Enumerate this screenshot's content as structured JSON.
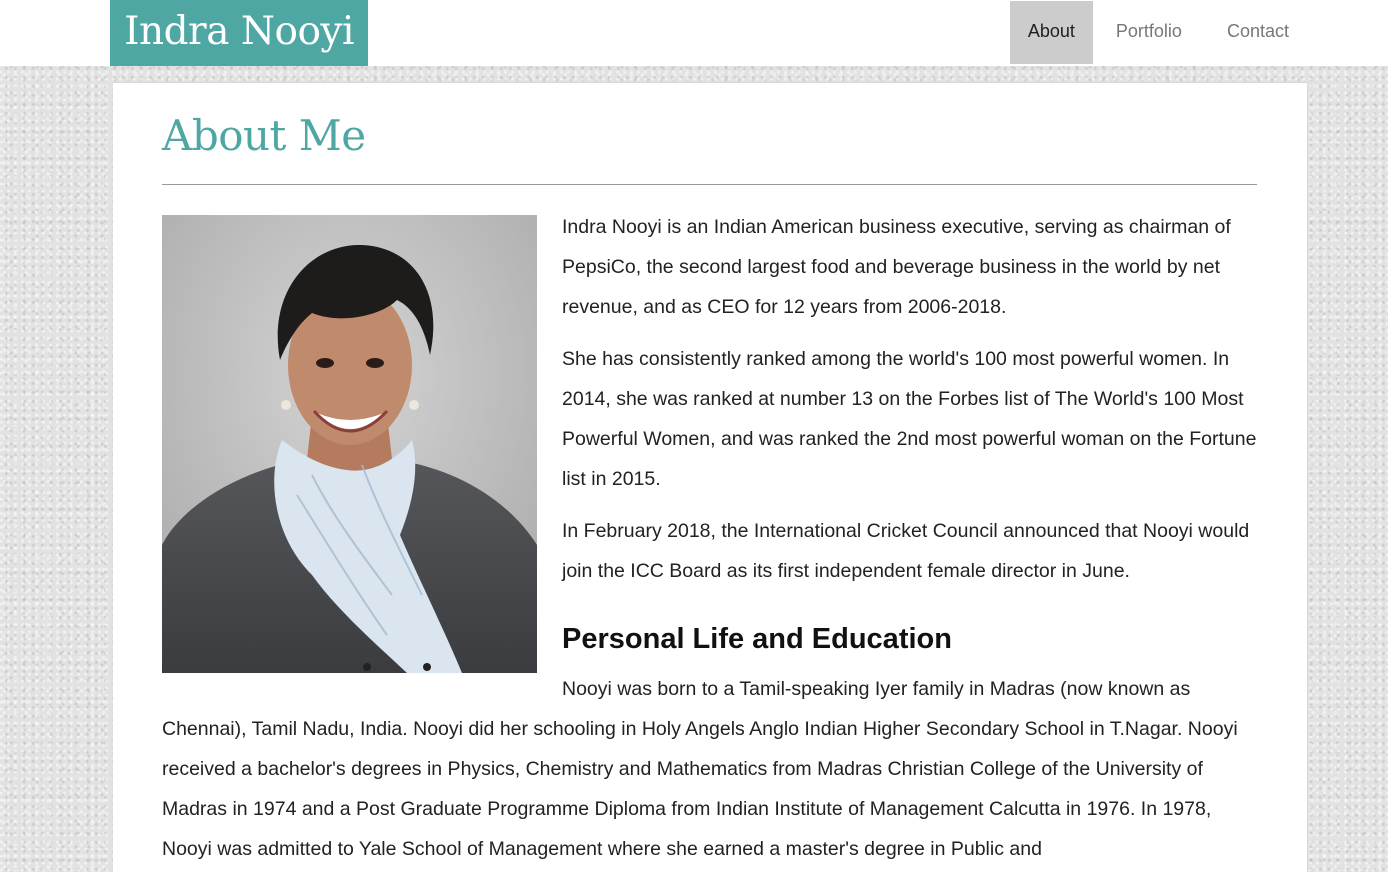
{
  "header": {
    "brand": "Indra Nooyi",
    "nav": [
      {
        "label": "About",
        "active": true
      },
      {
        "label": "Portfolio",
        "active": false
      },
      {
        "label": "Contact",
        "active": false
      }
    ]
  },
  "main": {
    "title": "About Me",
    "paragraphs": [
      "Indra Nooyi is an Indian American business executive, serving as chairman of PepsiCo, the second largest food and beverage business in the world by net revenue, and as CEO for 12 years from 2006-2018.",
      "She has consistently ranked among the world's 100 most powerful women. In 2014, she was ranked at number 13 on the Forbes list of The World's 100 Most Powerful Women, and was ranked the 2nd most powerful woman on the Fortune list in 2015.",
      "In February 2018, the International Cricket Council announced that Nooyi would join the ICC Board as its first independent female director in June."
    ],
    "section_title": "Personal Life and Education",
    "section_paragraph": "Nooyi was born to a Tamil-speaking Iyer family in Madras (now known as Chennai), Tamil Nadu, India. Nooyi did her schooling in Holy Angels Anglo Indian Higher Secondary School in T.Nagar. Nooyi received a bachelor's degrees in Physics, Chemistry and Mathematics from Madras Christian College of the University of Madras in 1974 and a Post Graduate Programme Diploma from Indian Institute of Management Calcutta in 1976. In 1978, Nooyi was admitted to Yale School of Management where she earned a master's degree in Public and"
  },
  "colors": {
    "accent": "#4fa7a3",
    "nav_active_bg": "#cccccc",
    "page_bg": "#e2e2e2",
    "card_bg": "#ffffff"
  }
}
